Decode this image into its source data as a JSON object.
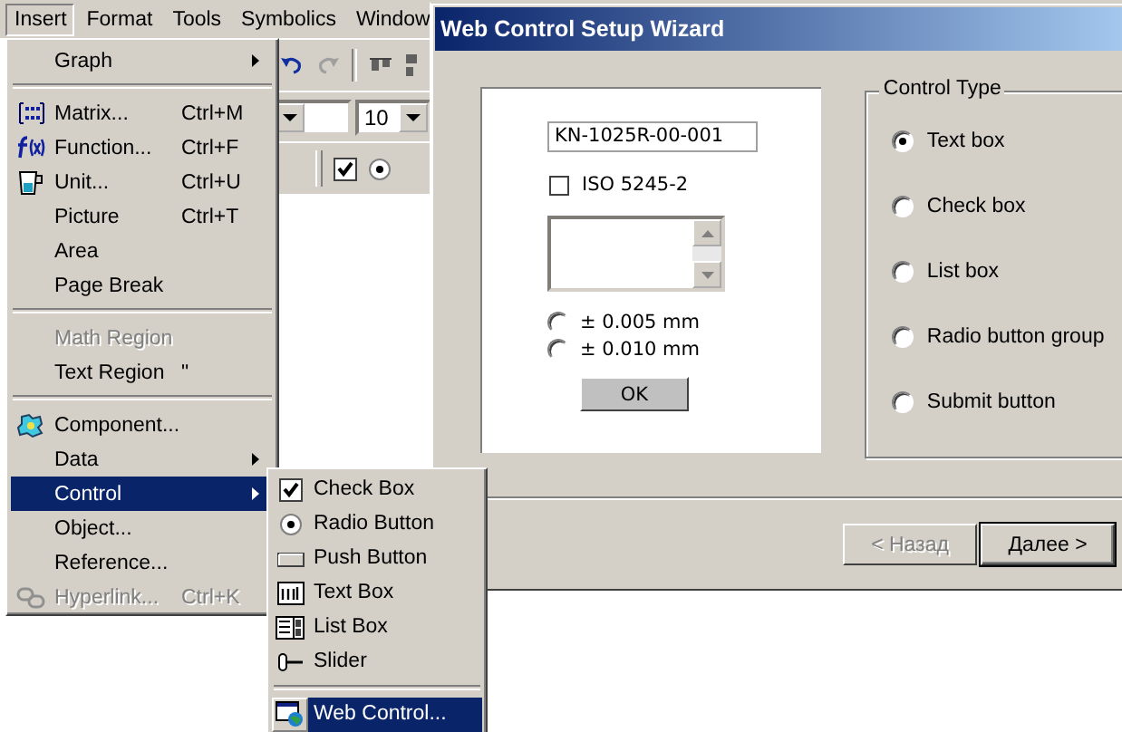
{
  "menubar": [
    {
      "label": "Insert",
      "selected": true
    },
    {
      "label": "Format",
      "selected": false
    },
    {
      "label": "Tools",
      "selected": false
    },
    {
      "label": "Symbolics",
      "selected": false
    },
    {
      "label": "Window",
      "selected": false
    }
  ],
  "toolbar": {
    "font_size": "10"
  },
  "insert_menu": [
    [
      {
        "label": "Graph",
        "submenu": true,
        "disabled": false,
        "selected": false
      }
    ],
    [
      {
        "label": "Matrix...",
        "shortcut": "Ctrl+M",
        "submenu": false,
        "disabled": false,
        "selected": false
      },
      {
        "label": "Function...",
        "shortcut": "Ctrl+F",
        "submenu": false,
        "disabled": false,
        "selected": false
      },
      {
        "label": "Unit...",
        "shortcut": "Ctrl+U",
        "submenu": false,
        "disabled": false,
        "selected": false
      },
      {
        "label": "Picture",
        "shortcut": "Ctrl+T",
        "submenu": false,
        "disabled": false,
        "selected": false
      },
      {
        "label": "Area",
        "submenu": false,
        "disabled": false,
        "selected": false
      },
      {
        "label": "Page Break",
        "submenu": false,
        "disabled": false,
        "selected": false
      }
    ],
    [
      {
        "label": "Math Region",
        "submenu": false,
        "disabled": true,
        "selected": false
      },
      {
        "label": "Text Region",
        "shortcut": "\"",
        "submenu": false,
        "disabled": false,
        "selected": false
      }
    ],
    [
      {
        "label": "Component...",
        "submenu": false,
        "disabled": false,
        "selected": false
      },
      {
        "label": "Data",
        "submenu": true,
        "disabled": false,
        "selected": false
      },
      {
        "label": "Control",
        "submenu": true,
        "disabled": false,
        "selected": true
      },
      {
        "label": "Object...",
        "submenu": false,
        "disabled": false,
        "selected": false
      },
      {
        "label": "Reference...",
        "submenu": false,
        "disabled": false,
        "selected": false
      },
      {
        "label": "Hyperlink...",
        "shortcut": "Ctrl+K",
        "submenu": false,
        "disabled": true,
        "selected": false
      }
    ]
  ],
  "control_submenu": [
    [
      {
        "label": "Check Box",
        "selected": false
      },
      {
        "label": "Radio Button",
        "selected": false
      },
      {
        "label": "Push Button",
        "selected": false
      },
      {
        "label": "Text Box",
        "selected": false
      },
      {
        "label": "List Box",
        "selected": false
      },
      {
        "label": "Slider",
        "selected": false
      }
    ],
    [
      {
        "label": "Web Control...",
        "selected": true
      }
    ]
  ],
  "dialog": {
    "title": "Web Control Setup Wizard",
    "preview": {
      "text_field": "KN-1025R-00-001",
      "checkbox": {
        "label": "ISO 5245-2",
        "checked": false
      },
      "radios": [
        {
          "label": "± 0.005 mm",
          "selected": false
        },
        {
          "label": "± 0.010 mm",
          "selected": false
        }
      ],
      "button": "OK"
    },
    "control_type": {
      "legend": "Control Type",
      "options": [
        {
          "label": "Text box",
          "selected": true
        },
        {
          "label": "Check box",
          "selected": false
        },
        {
          "label": "List box",
          "selected": false
        },
        {
          "label": "Radio button group",
          "selected": false
        },
        {
          "label": "Submit button",
          "selected": false
        }
      ]
    },
    "buttons": [
      {
        "label": "< Назад",
        "disabled": true,
        "default": false
      },
      {
        "label": "Далее >",
        "disabled": false,
        "default": true
      }
    ]
  }
}
